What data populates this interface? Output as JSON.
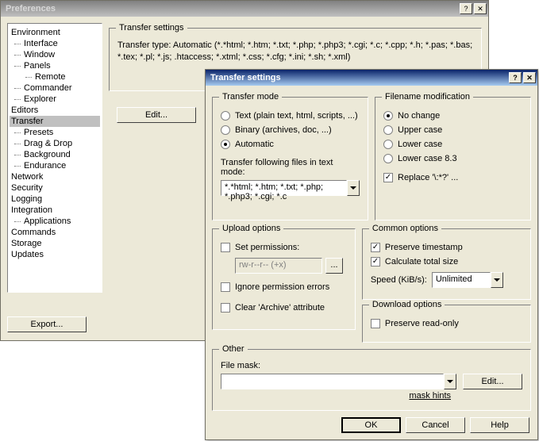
{
  "prefs": {
    "title": "Preferences",
    "tree": {
      "environment": "Environment",
      "interface": "Interface",
      "window": "Window",
      "panels": "Panels",
      "remote": "Remote",
      "commander": "Commander",
      "explorer": "Explorer",
      "editors": "Editors",
      "transfer": "Transfer",
      "presets": "Presets",
      "dragdrop": "Drag & Drop",
      "background": "Background",
      "endurance": "Endurance",
      "network": "Network",
      "security": "Security",
      "logging": "Logging",
      "integration": "Integration",
      "applications": "Applications",
      "commands": "Commands",
      "storage": "Storage",
      "updates": "Updates"
    },
    "transfer_settings_title": "Transfer settings",
    "transfer_type_text": "Transfer type: Automatic (*.*html; *.htm; *.txt; *.php; *.php3; *.cgi; *.c; *.cpp; *.h; *.pas; *.bas; *.tex; *.pl; *.js; .htaccess; *.xtml; *.css; *.cfg; *.ini; *.sh; *.xml)",
    "edit_btn": "Edit...",
    "export_btn": "Export..."
  },
  "dialog": {
    "title": "Transfer settings",
    "transfer_mode": {
      "title": "Transfer mode",
      "text": "Text (plain text, html, scripts, ...)",
      "binary": "Binary (archives, doc, ...)",
      "automatic": "Automatic",
      "following_label": "Transfer following files in text mode:",
      "patterns": "*.*html; *.htm; *.txt; *.php; *.php3; *.cgi; *.c"
    },
    "filename": {
      "title": "Filename modification",
      "no_change": "No change",
      "upper": "Upper case",
      "lower": "Lower case",
      "lower83": "Lower case 8.3",
      "replace": "Replace '\\:*?' ..."
    },
    "upload": {
      "title": "Upload options",
      "set_perm": "Set permissions:",
      "perm_value": "rw-r--r-- (+x)",
      "ignore_errors": "Ignore permission errors",
      "clear_archive": "Clear 'Archive' attribute"
    },
    "common": {
      "title": "Common options",
      "preserve_ts": "Preserve timestamp",
      "calc_size": "Calculate total size",
      "speed_label": "Speed (KiB/s):",
      "speed_value": "Unlimited"
    },
    "download": {
      "title": "Download options",
      "preserve_ro": "Preserve read-only"
    },
    "other": {
      "title": "Other",
      "file_mask_label": "File mask:",
      "file_mask_value": "",
      "edit_btn": "Edit...",
      "mask_hints": "mask hints"
    },
    "buttons": {
      "ok": "OK",
      "cancel": "Cancel",
      "help": "Help"
    }
  }
}
